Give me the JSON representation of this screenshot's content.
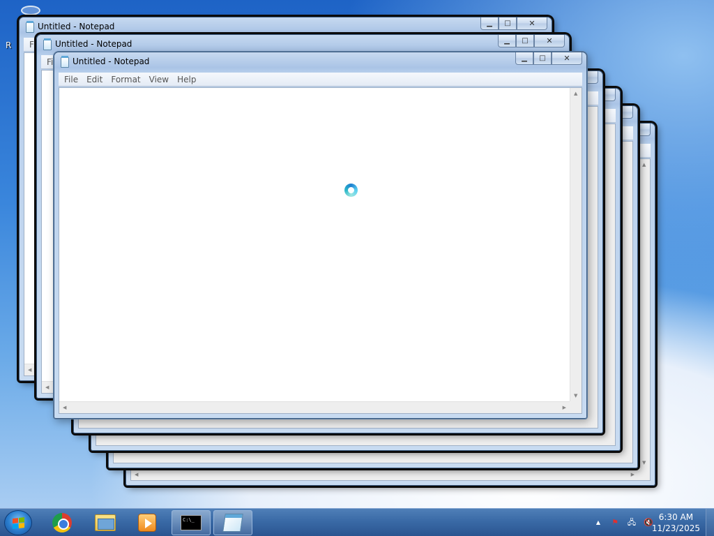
{
  "window": {
    "title": "Untitled - Notepad",
    "menu": [
      "File",
      "Edit",
      "Format",
      "View",
      "Help"
    ],
    "partial_menu_label": "Fi"
  },
  "desktop": {
    "partial_icon_label": "R"
  },
  "taskbar": {
    "apps": [
      {
        "name": "Google Chrome",
        "icon": "chrome-icon"
      },
      {
        "name": "Windows Explorer",
        "icon": "folder-icon"
      },
      {
        "name": "Windows Media Player",
        "icon": "media-player-icon"
      },
      {
        "name": "Command Prompt",
        "icon": "cmd-icon",
        "active": true
      },
      {
        "name": "Notepad",
        "icon": "notepad-icon",
        "active": true
      }
    ],
    "cmd_label": "C:\\_",
    "clock": {
      "time": "6:30 AM",
      "date": "11/23/2025"
    }
  },
  "colors": {
    "taskbar": "#3a6aa6",
    "window_frame": "#b9d0ec",
    "busy_cursor": "#1d7fd0"
  }
}
